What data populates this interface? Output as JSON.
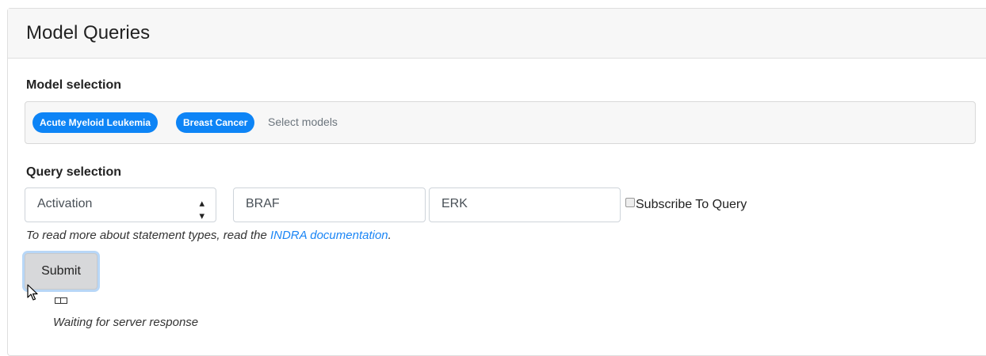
{
  "card": {
    "title": "Model Queries"
  },
  "model_selection": {
    "label": "Model selection",
    "selected": [
      "Acute Myeloid Leukemia",
      "Breast Cancer"
    ],
    "placeholder": "Select models"
  },
  "query_selection": {
    "label": "Query selection",
    "statement_type": "Activation",
    "subject": "BRAF",
    "object": "ERK",
    "subscribe_label": "Subscribe To Query",
    "subscribe_checked": false,
    "help_prefix": "To read more about statement types, read the ",
    "help_link": "INDRA documentation",
    "help_suffix": "."
  },
  "submit_label": "Submit",
  "status": {
    "waiting_text": "Waiting for server response",
    "loader_icon": "loading-icon"
  },
  "colors": {
    "accent": "#0d84f6",
    "link": "#1a85f5"
  }
}
